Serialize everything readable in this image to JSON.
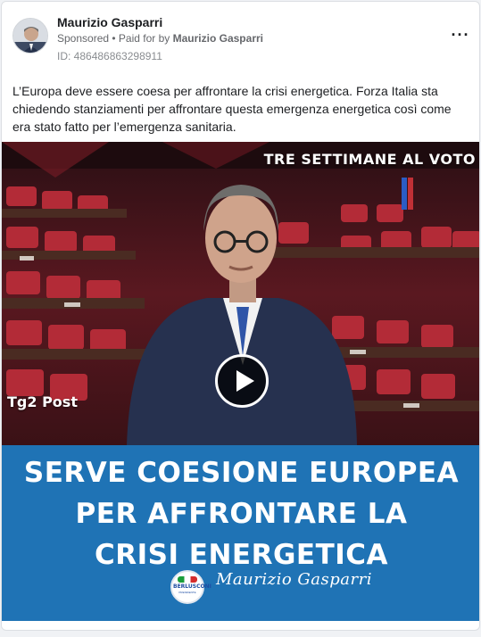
{
  "post": {
    "page_name": "Maurizio Gasparri",
    "sponsored": "Sponsored",
    "paid_for_prefix": " • Paid for by ",
    "paid_for_name": "Maurizio Gasparri",
    "ad_id": "ID: 486486863298911",
    "more_icon": "more-horizontal-icon",
    "text": "L’Europa deve essere coesa per affrontare la crisi energetica. Forza Italia sta chiedendo stanziamenti per affrontare questa emergenza energetica così come era stato fatto per l’emergenza sanitaria."
  },
  "media": {
    "top_label": "TRE SETTIMANE AL VOTO",
    "channel_logo": "Tg2 Post",
    "headline_lines": [
      "SERVE COESIONE EUROPEA",
      "PER AFFRONTARE LA",
      "CRISI ENERGETICA"
    ],
    "party_logo_text": "BERLUSCONI",
    "party_logo_sub": "PRESIDENTE",
    "signature": "Maurizio Gasparri",
    "play_icon": "play-icon",
    "colors": {
      "banner": "#1f73b5",
      "room": "#7a1f2b"
    }
  }
}
